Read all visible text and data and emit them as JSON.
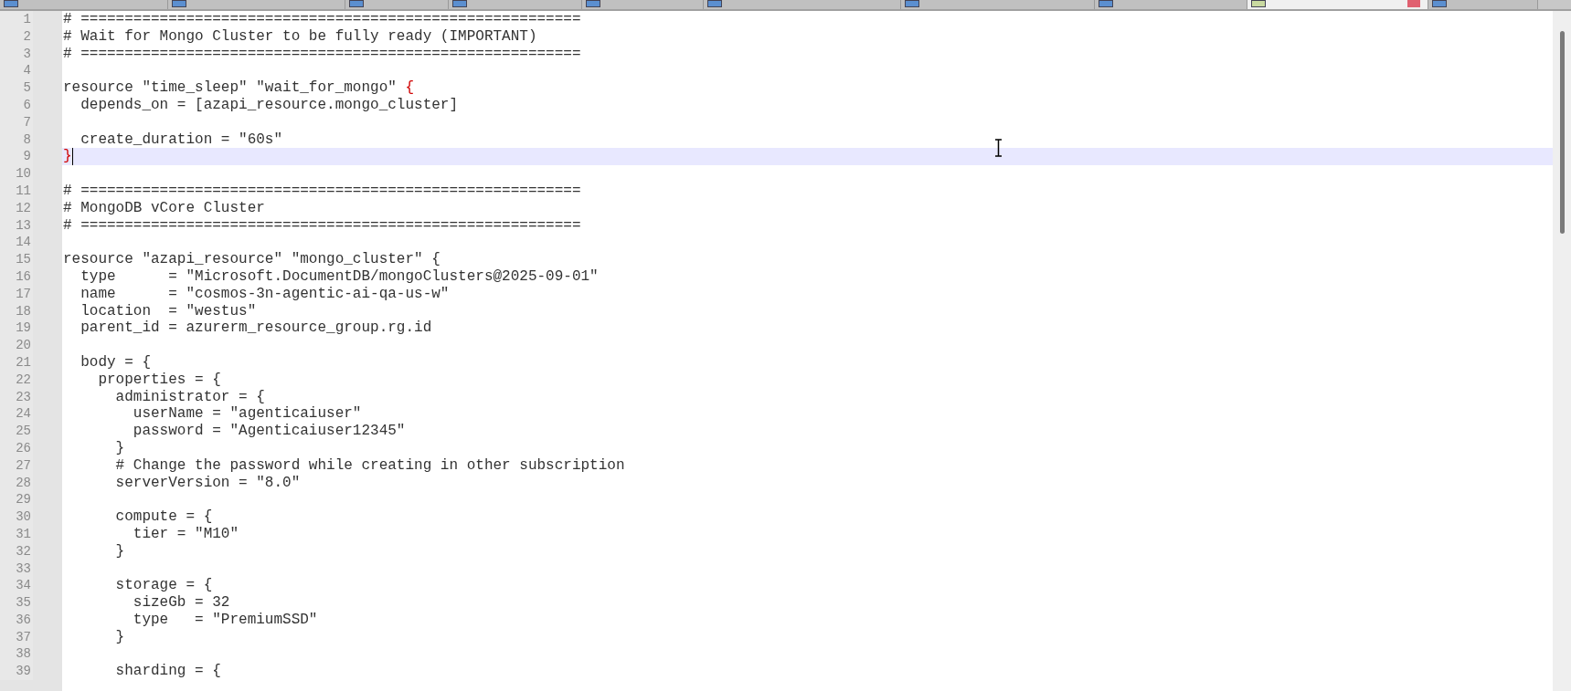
{
  "tabs": [
    {
      "selected": false
    },
    {
      "selected": false
    },
    {
      "selected": false
    },
    {
      "selected": false
    },
    {
      "selected": false
    },
    {
      "selected": false
    },
    {
      "selected": false
    },
    {
      "selected": false
    },
    {
      "selected": true
    },
    {
      "selected": false
    }
  ],
  "editor": {
    "lines": [
      {
        "number": "1",
        "text": "# ========================================================="
      },
      {
        "number": "2",
        "text": "# Wait for Mongo Cluster to be fully ready (IMPORTANT)"
      },
      {
        "number": "3",
        "text": "# ========================================================="
      },
      {
        "number": "4"
      },
      {
        "number": "5",
        "text": "resource \"time_sleep\" \"wait_for_mongo\" ",
        "brace": "{"
      },
      {
        "number": "6",
        "text": "  depends_on = [azapi_resource.mongo_cluster]"
      },
      {
        "number": "7"
      },
      {
        "number": "8",
        "text": "  create_duration = \"60s\""
      },
      {
        "number": "9",
        "brace": "}",
        "current": true
      },
      {
        "number": "10"
      },
      {
        "number": "11",
        "text": "# ========================================================="
      },
      {
        "number": "12",
        "text": "# MongoDB vCore Cluster"
      },
      {
        "number": "13",
        "text": "# ========================================================="
      },
      {
        "number": "14"
      },
      {
        "number": "15",
        "text": "resource \"azapi_resource\" \"mongo_cluster\" {"
      },
      {
        "number": "16",
        "text": "  type      = \"Microsoft.DocumentDB/mongoClusters@2025-09-01\""
      },
      {
        "number": "17",
        "text": "  name      = \"cosmos-3n-agentic-ai-qa-us-w\""
      },
      {
        "number": "18",
        "text": "  location  = \"westus\""
      },
      {
        "number": "19",
        "text": "  parent_id = azurerm_resource_group.rg.id"
      },
      {
        "number": "20"
      },
      {
        "number": "21",
        "text": "  body = {"
      },
      {
        "number": "22",
        "text": "    properties = {"
      },
      {
        "number": "23",
        "text": "      administrator = {"
      },
      {
        "number": "24",
        "text": "        userName = \"agenticaiuser\""
      },
      {
        "number": "25",
        "text": "        password = \"Agenticaiuser12345\""
      },
      {
        "number": "26",
        "text": "      }"
      },
      {
        "number": "27",
        "text": "      # Change the password while creating in other subscription"
      },
      {
        "number": "28",
        "text": "      serverVersion = \"8.0\""
      },
      {
        "number": "29"
      },
      {
        "number": "30",
        "text": "      compute = {"
      },
      {
        "number": "31",
        "text": "        tier = \"M10\""
      },
      {
        "number": "32",
        "text": "      }"
      },
      {
        "number": "33"
      },
      {
        "number": "34",
        "text": "      storage = {"
      },
      {
        "number": "35",
        "text": "        sizeGb = 32"
      },
      {
        "number": "36",
        "text": "        type   = \"PremiumSSD\""
      },
      {
        "number": "37",
        "text": "      }"
      },
      {
        "number": "38"
      },
      {
        "number": "39",
        "text": "      sharding = {"
      }
    ]
  }
}
